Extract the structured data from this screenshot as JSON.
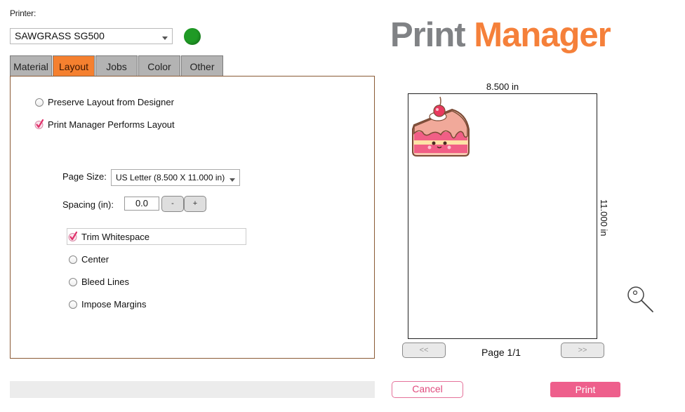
{
  "printer": {
    "label": "Printer:",
    "selected": "SAWGRASS SG500",
    "status_color": "#1f9a25"
  },
  "tabs": [
    {
      "label": "Material",
      "active": false
    },
    {
      "label": "Layout",
      "active": true
    },
    {
      "label": "Jobs",
      "active": false
    },
    {
      "label": "Color",
      "active": false
    },
    {
      "label": "Other",
      "active": false
    }
  ],
  "layout": {
    "mode_options": [
      {
        "label": "Preserve Layout from Designer",
        "checked": false
      },
      {
        "label": "Print Manager Performs Layout",
        "checked": true
      }
    ],
    "page_size_label": "Page Size:",
    "page_size_value": "US Letter (8.500 X 11.000 in)",
    "spacing_label": "Spacing (in):",
    "spacing_value": "0.0",
    "decrement_label": "-",
    "increment_label": "+",
    "options": [
      {
        "label": "Trim Whitespace",
        "checked": true
      },
      {
        "label": "Center",
        "checked": false
      },
      {
        "label": "Bleed Lines",
        "checked": false
      },
      {
        "label": "Impose Margins",
        "checked": false
      }
    ]
  },
  "logo": {
    "part1": "Print",
    "part2": "Manager"
  },
  "preview": {
    "width_label": "8.500 in",
    "height_label": "11.000 in",
    "image_icon": "cake-slice-image",
    "zoom_icon": "magnifier-icon",
    "prev_label": "<<",
    "next_label": ">>",
    "page_label": "Page 1/1"
  },
  "actions": {
    "cancel_label": "Cancel",
    "print_label": "Print"
  },
  "colors": {
    "accent": "#f5802f",
    "pink": "#ee5f8c",
    "logo_gray": "#808285"
  }
}
